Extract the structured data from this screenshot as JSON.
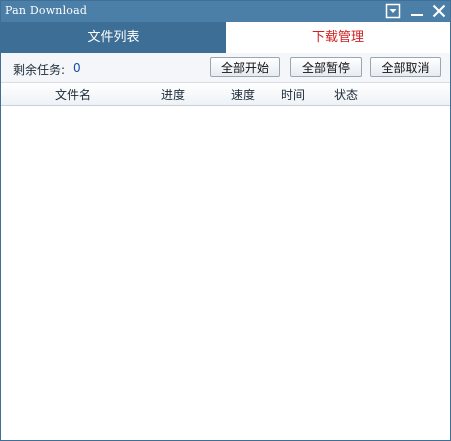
{
  "window": {
    "title": "Pan Download"
  },
  "titlebar_buttons": {
    "menu_icon": "dropdown-menu-icon",
    "minimize_icon": "minimize-icon",
    "close_icon": "close-icon"
  },
  "tabs": [
    {
      "label": "文件列表",
      "active": false
    },
    {
      "label": "下载管理",
      "active": true
    }
  ],
  "actionbar": {
    "remaining_label": "剩余任务:",
    "remaining_count": "0",
    "start_all": "全部开始",
    "pause_all": "全部暂停",
    "cancel_all": "全部取消"
  },
  "columns": [
    "文件名",
    "进度",
    "速度",
    "时间",
    "状态"
  ],
  "colors": {
    "titlebar": "#4c7fa7",
    "tab_inactive": "#3d6e95",
    "tab_active_text": "#d11f1f",
    "count_text": "#1a4aa8"
  }
}
